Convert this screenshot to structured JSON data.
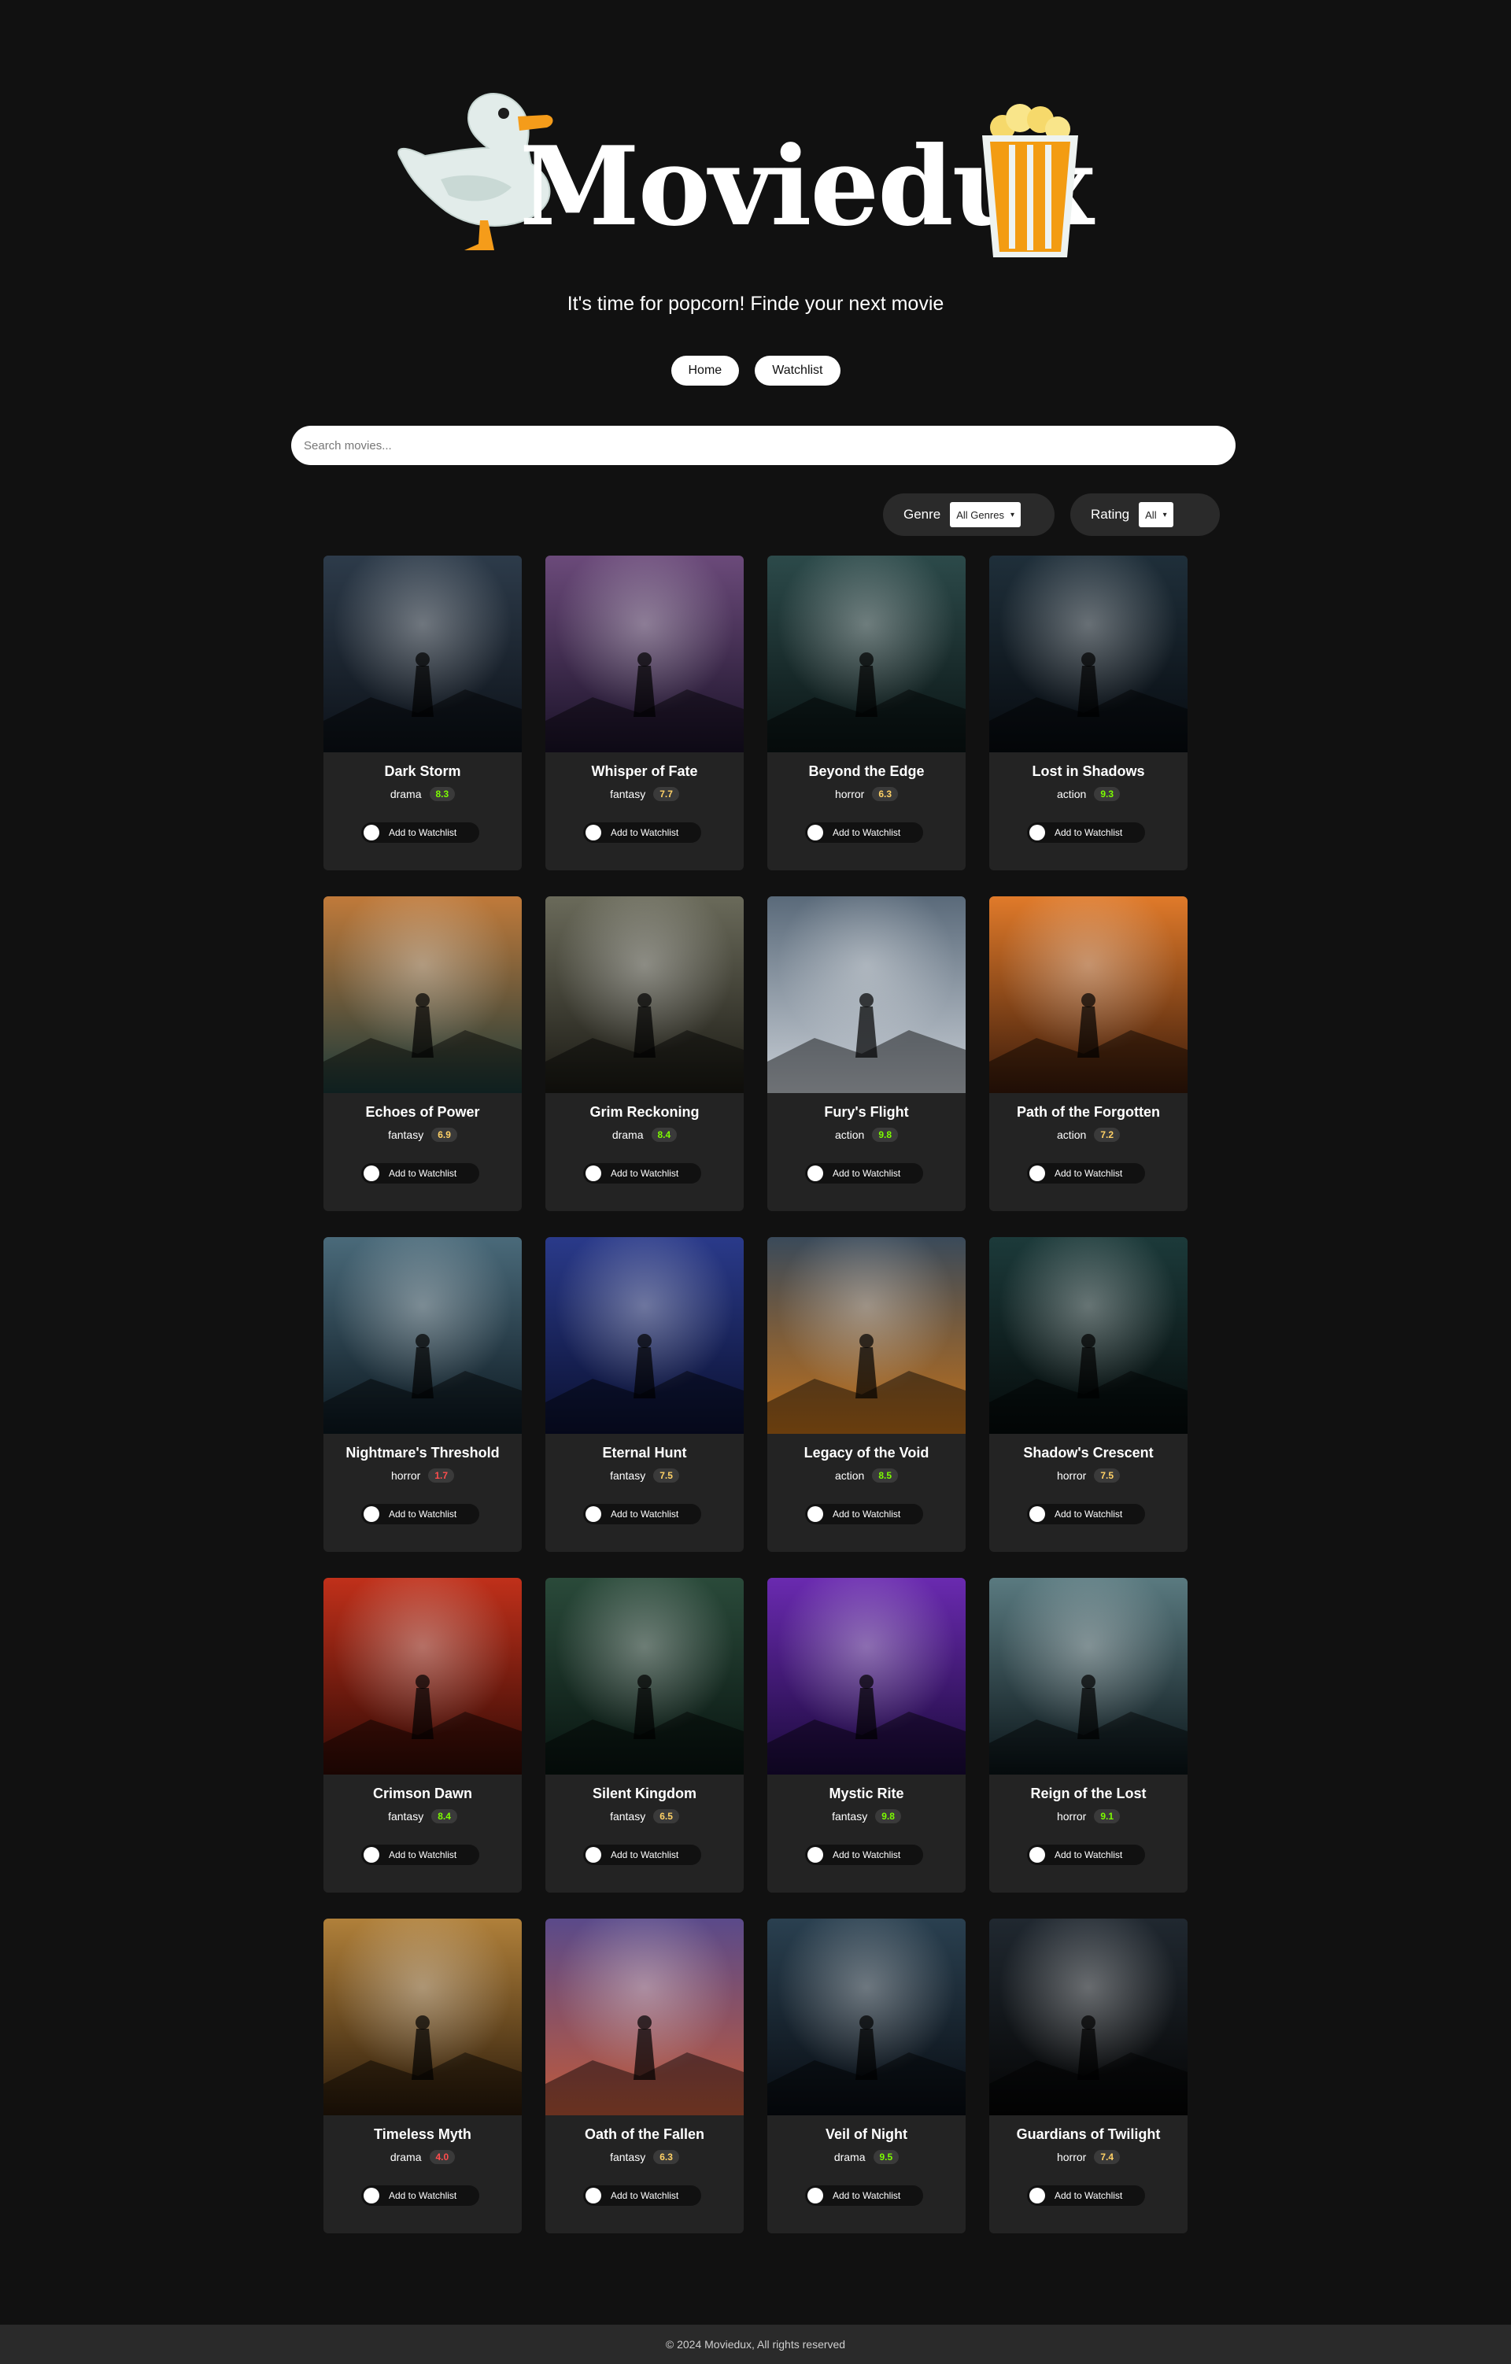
{
  "header": {
    "logo_text": "Moviedux",
    "duck_icon": "duck-icon",
    "popcorn_icon": "popcorn-icon",
    "tagline": "It's time for popcorn! Finde your next movie"
  },
  "nav": {
    "home_label": "Home",
    "watchlist_label": "Watchlist"
  },
  "search": {
    "placeholder": "Search movies...",
    "value": ""
  },
  "filters": {
    "genre_label": "Genre",
    "genre_selected": "All Genres",
    "rating_label": "Rating",
    "rating_selected": "All"
  },
  "card": {
    "watchlist_label": "Add to Watchlist"
  },
  "colors": {
    "background": "#111111",
    "card": "#232323",
    "rating_good": "#7CFC00",
    "rating_ok": "#FFD166",
    "rating_bad": "#FF4D4D"
  },
  "movies": [
    {
      "title": "Dark Storm",
      "genre": "drama",
      "rating": "8.3"
    },
    {
      "title": "Whisper of Fate",
      "genre": "fantasy",
      "rating": "7.7"
    },
    {
      "title": "Beyond the Edge",
      "genre": "horror",
      "rating": "6.3"
    },
    {
      "title": "Lost in Shadows",
      "genre": "action",
      "rating": "9.3"
    },
    {
      "title": "Echoes of Power",
      "genre": "fantasy",
      "rating": "6.9"
    },
    {
      "title": "Grim Reckoning",
      "genre": "drama",
      "rating": "8.4"
    },
    {
      "title": "Fury's Flight",
      "genre": "action",
      "rating": "9.8"
    },
    {
      "title": "Path of the Forgotten",
      "genre": "action",
      "rating": "7.2"
    },
    {
      "title": "Nightmare's Threshold",
      "genre": "horror",
      "rating": "1.7"
    },
    {
      "title": "Eternal Hunt",
      "genre": "fantasy",
      "rating": "7.5"
    },
    {
      "title": "Legacy of the Void",
      "genre": "action",
      "rating": "8.5"
    },
    {
      "title": "Shadow's Crescent",
      "genre": "horror",
      "rating": "7.5"
    },
    {
      "title": "Crimson Dawn",
      "genre": "fantasy",
      "rating": "8.4"
    },
    {
      "title": "Silent Kingdom",
      "genre": "fantasy",
      "rating": "6.5"
    },
    {
      "title": "Mystic Rite",
      "genre": "fantasy",
      "rating": "9.8"
    },
    {
      "title": "Reign of the Lost",
      "genre": "horror",
      "rating": "9.1"
    },
    {
      "title": "Timeless Myth",
      "genre": "drama",
      "rating": "4.0"
    },
    {
      "title": "Oath of the Fallen",
      "genre": "fantasy",
      "rating": "6.3"
    },
    {
      "title": "Veil of Night",
      "genre": "drama",
      "rating": "9.5"
    },
    {
      "title": "Guardians of Twilight",
      "genre": "horror",
      "rating": "7.4"
    }
  ],
  "footer": {
    "text": "© 2024 Moviedux, All rights reserved"
  }
}
